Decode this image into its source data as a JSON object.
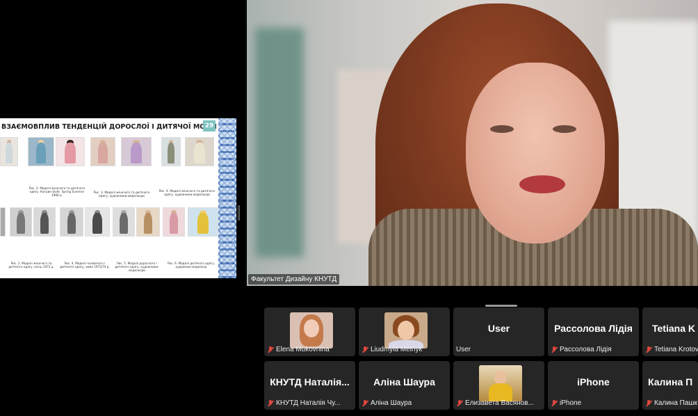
{
  "slide": {
    "title": "ВЗАЄМОВПЛИВ ТЕНДЕНЦІЙ ДОРОСЛОЇ І ДИТЯЧОЇ МОДИ",
    "page_number": "29",
    "captions_top": [
      "Рис. 2. Моделі жіночого та дитячого одягу. Катрин Sixth. Spring Summer 1966 р.",
      "Рис. 3. Моделі жіночого та дитячого одягу, художники-модельєри",
      "Рис. 4. Моделі жіночого та дитячого одягу, художники-модельєри"
    ],
    "captions_bottom": [
      "Рис. 2. Моделі жіночого та дитячого одягу, осінь 1972 р.",
      "Рис. 4. Моделі чоловічого і дитячого одягу, зима 1973/74 р.",
      "Рис. 5. Моделі дорослого і дитячого одягу, художники-модельєри",
      "Рис. 6. Моделі дитячого одягу, художник-модельєр"
    ]
  },
  "speaker": {
    "name": "Факультет Дизайну КНУТД"
  },
  "participants": [
    {
      "display": "avatar",
      "avatar_color": "#d9c0b3",
      "label": "Elena Mukovnina",
      "muted": true
    },
    {
      "display": "avatar",
      "avatar_color": "#c8a98a",
      "label": "Liudmyla Melnyk",
      "muted": true
    },
    {
      "display": "name",
      "big": "User",
      "label": "User",
      "muted": false
    },
    {
      "display": "name",
      "big": "Рассолова Лідія",
      "label": "Рассолова Лідія",
      "muted": true
    },
    {
      "display": "name",
      "big": "Tetiana K",
      "label": "Tetiana Krotov",
      "muted": true
    },
    {
      "display": "name",
      "big": "КНУТД Наталія...",
      "label": "КНУТД Наталія Чу...",
      "muted": true
    },
    {
      "display": "name",
      "big": "Аліна Шаура",
      "label": "Аліна Шаура",
      "muted": true
    },
    {
      "display": "avatar",
      "avatar_color": "#c9a25a",
      "label": "Елизавета Васянов...",
      "muted": true
    },
    {
      "display": "name",
      "big": "iPhone",
      "label": "iPhone",
      "muted": true
    },
    {
      "display": "name",
      "big": "Калина П",
      "label": "Калина Пашк",
      "muted": true
    }
  ]
}
